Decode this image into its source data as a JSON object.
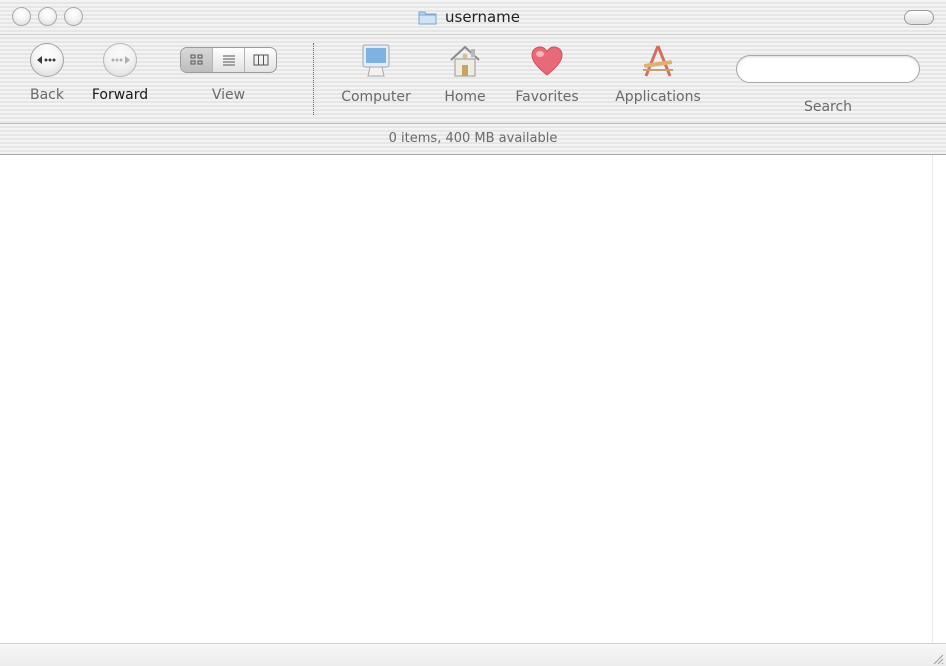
{
  "window": {
    "title": "username",
    "traffic_lights": [
      "close",
      "minimize",
      "zoom"
    ]
  },
  "toolbar": {
    "back": {
      "label": "Back",
      "icon": "back-arrow-icon"
    },
    "forward": {
      "label": "Forward",
      "icon": "forward-arrow-icon"
    },
    "view": {
      "label": "View",
      "options": [
        "icon",
        "list",
        "column"
      ],
      "selected": "icon"
    },
    "locations": [
      {
        "label": "Computer",
        "icon": "computer-icon"
      },
      {
        "label": "Home",
        "icon": "home-icon"
      },
      {
        "label": "Favorites",
        "icon": "heart-icon"
      },
      {
        "label": "Applications",
        "icon": "applications-icon"
      }
    ],
    "search": {
      "label": "Search",
      "value": "",
      "placeholder": ""
    }
  },
  "status": {
    "text": "0 items, 400 MB available"
  },
  "colors": {
    "heart": "#e86a78",
    "monitor": "#7fb2e0",
    "accent": "#6a6a6a"
  }
}
